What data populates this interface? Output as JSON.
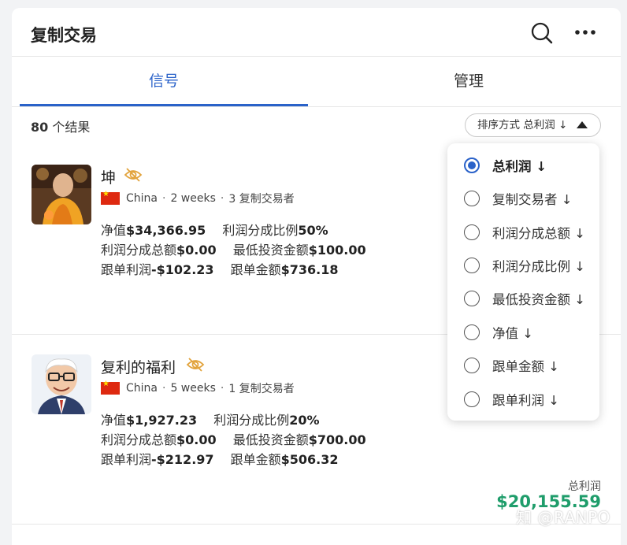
{
  "header": {
    "title": "复制交易"
  },
  "tabs": [
    {
      "label": "信号",
      "active": true
    },
    {
      "label": "管理",
      "active": false
    }
  ],
  "results": {
    "count": "80",
    "suffix": " 个结果"
  },
  "sort": {
    "label": "排序方式 总利润 ↓"
  },
  "dropdown": {
    "options": [
      {
        "label": "总利润 ↓",
        "selected": true
      },
      {
        "label": "复制交易者 ↓",
        "selected": false
      },
      {
        "label": "利润分成总额 ↓",
        "selected": false
      },
      {
        "label": "利润分成比例 ↓",
        "selected": false
      },
      {
        "label": "最低投资金额 ↓",
        "selected": false
      },
      {
        "label": "净值 ↓",
        "selected": false
      },
      {
        "label": "跟单金额 ↓",
        "selected": false
      },
      {
        "label": "跟单利润 ↓",
        "selected": false
      }
    ]
  },
  "signals": [
    {
      "name": "坤",
      "country": "China",
      "age": "2 weeks",
      "copiers": "3 复制交易者",
      "equity_label": "净值",
      "equity": "$34,366.95",
      "share_ratio_label": "利润分成比例",
      "share_ratio": "50%",
      "share_total_label": "利润分成总额",
      "share_total": "$0.00",
      "min_invest_label": "最低投资金额",
      "min_invest": "$100.00",
      "copy_profit_label": "跟单利润",
      "copy_profit": "-$102.23",
      "copy_amount_label": "跟单金额",
      "copy_amount": "$736.18"
    },
    {
      "name": "复利的福利",
      "country": "China",
      "age": "5 weeks",
      "copiers": "1 复制交易者",
      "equity_label": "净值",
      "equity": "$1,927.23",
      "share_ratio_label": "利润分成比例",
      "share_ratio": "20%",
      "share_total_label": "利润分成总额",
      "share_total": "$0.00",
      "min_invest_label": "最低投资金额",
      "min_invest": "$700.00",
      "copy_profit_label": "跟单利润",
      "copy_profit": "-$212.97",
      "copy_amount_label": "跟单金额",
      "copy_amount": "$506.32",
      "total_profit_label": "总利润",
      "total_profit": "$20,155.59"
    }
  ],
  "watermark": "知 @RANPO",
  "colors": {
    "accent": "#2a62c9",
    "profit_green": "#1f9d6b"
  }
}
